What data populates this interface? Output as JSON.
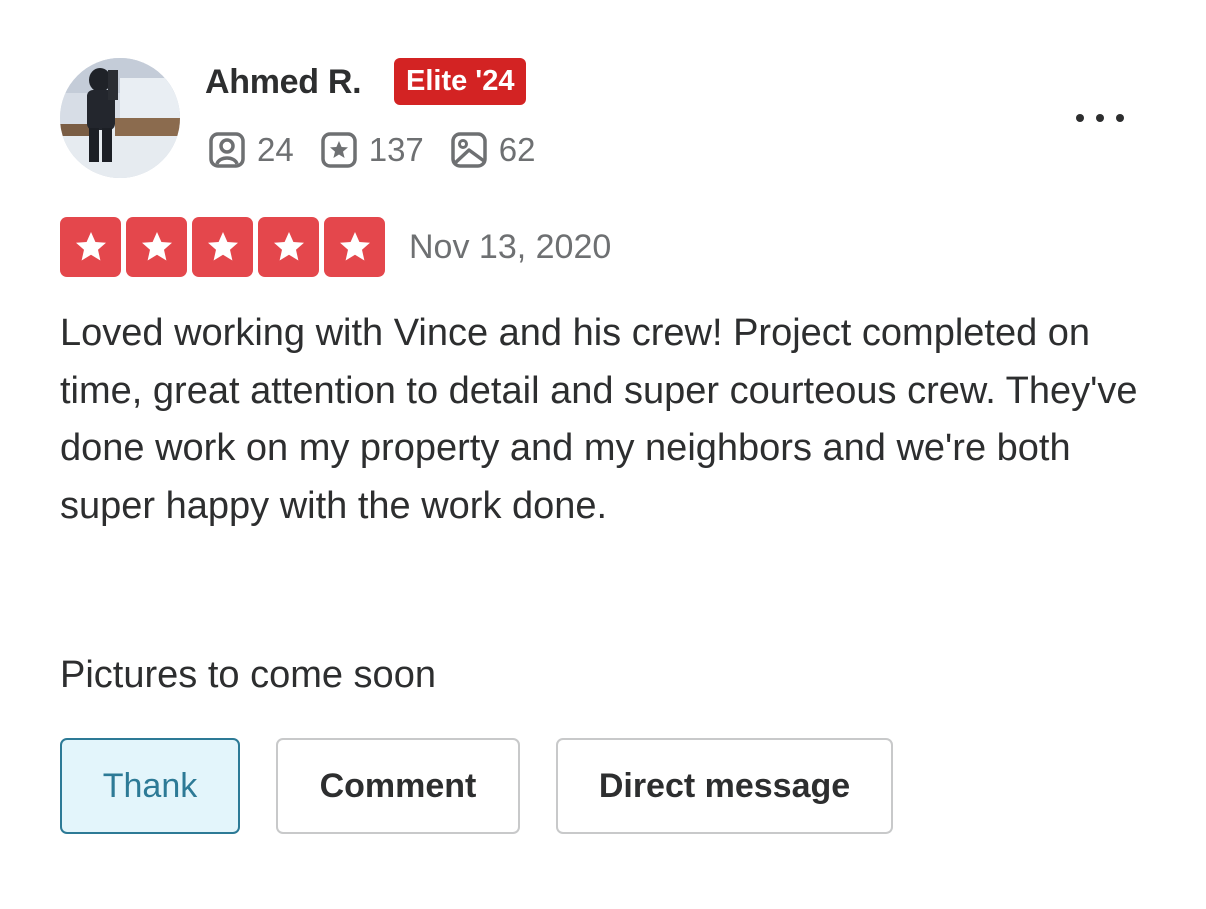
{
  "user": {
    "name": "Ahmed R.",
    "badge": "Elite '24",
    "stats": {
      "friends": "24",
      "reviews": "137",
      "photos": "62"
    },
    "avatar_icon": "user-avatar-photo"
  },
  "review": {
    "rating": 5,
    "rating_max": 5,
    "star_color": "#e4474c",
    "date": "Nov 13, 2020",
    "text": "Loved working with Vince and his crew! Project completed on time, great attention to detail and super courteous crew. They've done work on my property and my neighbors and we're both super happy with the work done.",
    "text_2": "Pictures to come soon"
  },
  "actions": {
    "thank_label": "Thank",
    "comment_label": "Comment",
    "direct_message_label": "Direct message"
  },
  "colors": {
    "elite_badge": "#d32323",
    "thank_accent": "#2d7a96",
    "thank_background": "#e3f5fb"
  },
  "icons": {
    "friends": "friends-icon",
    "reviews": "review-star-icon",
    "photos": "photo-icon",
    "menu": "more-options-icon"
  }
}
